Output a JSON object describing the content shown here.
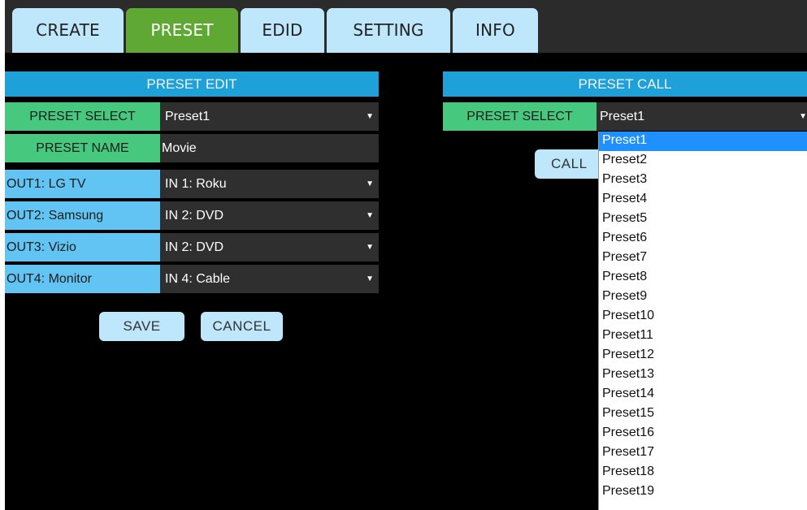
{
  "tabs": [
    {
      "label": "CREATE",
      "active": false
    },
    {
      "label": "PRESET",
      "active": true
    },
    {
      "label": "EDID",
      "active": false
    },
    {
      "label": "SETTING",
      "active": false
    },
    {
      "label": "INFO",
      "active": false
    }
  ],
  "preset_edit": {
    "title": "PRESET EDIT",
    "select_label": "PRESET SELECT",
    "select_value": "Preset1",
    "name_label": "PRESET NAME",
    "name_value": "Movie",
    "outputs": [
      {
        "label": "OUT1: LG TV",
        "value": "IN 1: Roku"
      },
      {
        "label": "OUT2: Samsung",
        "value": "IN 2: DVD"
      },
      {
        "label": "OUT3: Vizio",
        "value": "IN 2: DVD"
      },
      {
        "label": "OUT4: Monitor",
        "value": "IN 4: Cable"
      }
    ],
    "save_label": "SAVE",
    "cancel_label": "CANCEL"
  },
  "preset_call": {
    "title": "PRESET CALL",
    "select_label": "PRESET SELECT",
    "select_value": "Preset1",
    "call_label": "CALL",
    "options": [
      "Preset1",
      "Preset2",
      "Preset3",
      "Preset4",
      "Preset5",
      "Preset6",
      "Preset7",
      "Preset8",
      "Preset9",
      "Preset10",
      "Preset11",
      "Preset12",
      "Preset13",
      "Preset14",
      "Preset15",
      "Preset16",
      "Preset17",
      "Preset18",
      "Preset19"
    ],
    "highlighted_option": "Preset1"
  },
  "icons": {
    "dropdown_arrow": "triangle-down-icon"
  },
  "colors": {
    "tab": "#bfe7fb",
    "tab_active": "#5fa833",
    "header": "#1ea0d9",
    "label_green": "#46c97e",
    "label_blue": "#61c4f3",
    "option_highlight": "#1e90ff"
  }
}
